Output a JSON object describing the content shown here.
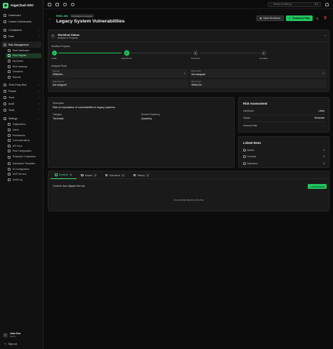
{
  "app": {
    "name": "GigaChad GRC"
  },
  "sidebar": {
    "top": [
      {
        "label": "Dashboard"
      },
      {
        "label": "Custom Dashboards"
      }
    ],
    "sections1": [
      {
        "label": "Compliance"
      },
      {
        "label": "Data"
      }
    ],
    "risk": {
      "label": "Risk Management",
      "items": [
        "Risk Dashboard",
        "Risk Register",
        "My Queue",
        "Risk Heatmap",
        "Scenarios",
        "Reports"
      ]
    },
    "sections2": [
      {
        "label": "Third-Party Risk"
      },
      {
        "label": "People"
      },
      {
        "label": "Trust"
      },
      {
        "label": "Audit"
      },
      {
        "label": "Tools"
      }
    ],
    "settings": {
      "label": "Settings",
      "items": [
        "Organization",
        "Users",
        "Permissions",
        "Communications",
        "API Keys",
        "Risk Configuration",
        "Employee Compliance",
        "Dashboard Templates",
        "AI Configuration",
        "MCP Servers",
        "Audit Log"
      ]
    },
    "user": {
      "initial": "J",
      "name": "John Doe",
      "role": "Admin"
    },
    "signout": "Sign out"
  },
  "topbar": {
    "search_placeholder": "Search everything...",
    "shortcut": "⌘K"
  },
  "header": {
    "risk_id": "RISK-408",
    "status_badge": "risk analysis in progress",
    "title": "Legacy System Vulnerabilities",
    "mark_reviewed": "Mark Reviewed",
    "treatment_plan": "Treatment Plan"
  },
  "workflow": {
    "title": "Workflow Status",
    "subtitle": "Analysis in Progress",
    "progress_label": "Workflow Progress",
    "steps": [
      {
        "num": "1",
        "label": "Intake",
        "state": "done"
      },
      {
        "num": "2",
        "label": "Assessment",
        "state": "current"
      },
      {
        "num": "3",
        "label": "Treatment",
        "state": "todo"
      },
      {
        "num": "4",
        "label": "Complete",
        "state": "todo"
      }
    ],
    "assigned_label": "Assigned Roles",
    "roles": [
      {
        "key": "Reporter",
        "value": "9f98e42b..."
      },
      {
        "key": "Risk Owner",
        "value": "Not assigned"
      },
      {
        "key": "Risk Assessor",
        "value": "Not assigned"
      },
      {
        "key": "Risk Owner",
        "value": "9f98e42b..."
      }
    ]
  },
  "description": {
    "label": "Description",
    "text": "Risk of exploitation of vulnerabilities in legacy systems",
    "category_label": "Category",
    "category": "Technical",
    "review_label": "Review Frequency",
    "review": "Quarterly"
  },
  "risk_assessment": {
    "title": "Risk Assessment",
    "rows": [
      {
        "k": "Likelihood",
        "v": "Likely"
      },
      {
        "k": "Impact",
        "v": "Moderate"
      },
      {
        "k": "Inherent Risk",
        "v": "-"
      }
    ]
  },
  "linked_items": {
    "title": "Linked Items",
    "rows": [
      {
        "k": "Assets",
        "v": "0"
      },
      {
        "k": "Controls",
        "v": "0"
      },
      {
        "k": "Scenarios",
        "v": "0"
      }
    ]
  },
  "tabs": [
    {
      "label": "Controls",
      "count": "0"
    },
    {
      "label": "Assets",
      "count": "0"
    },
    {
      "label": "Scenarios",
      "count": "0"
    },
    {
      "label": "History",
      "count": "0"
    }
  ],
  "controls_panel": {
    "heading": "Controls that mitigate this risk",
    "link_button": "+ Link Control",
    "empty": "No controls linked to this risk"
  }
}
